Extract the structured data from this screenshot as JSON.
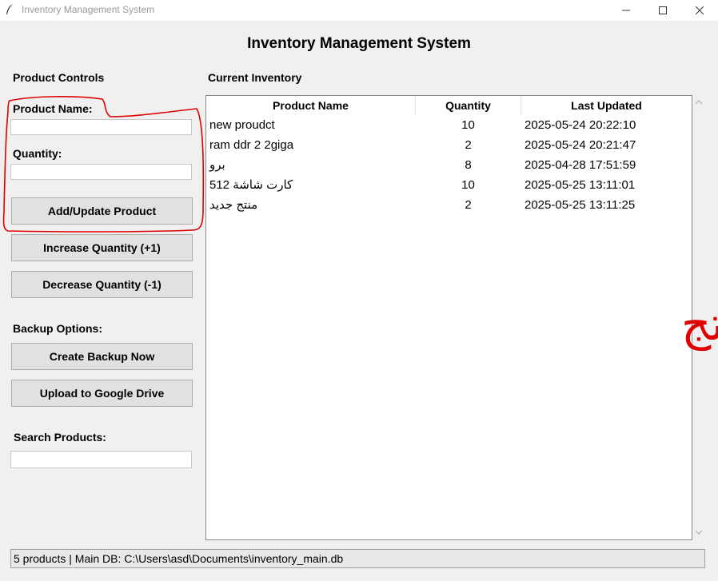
{
  "window": {
    "title": "Inventory Management System"
  },
  "app": {
    "title": "Inventory Management System"
  },
  "controls": {
    "heading": "Product Controls",
    "product_name_label": "Product Name:",
    "quantity_label": "Quantity:",
    "add_update_label": "Add/Update Product",
    "increase_label": "Increase Quantity (+1)",
    "decrease_label": "Decrease Quantity (-1)",
    "backup_heading": "Backup Options:",
    "create_backup_label": "Create Backup Now",
    "upload_drive_label": "Upload to Google Drive",
    "search_label": "Search Products:"
  },
  "inventory": {
    "heading": "Current Inventory",
    "columns": [
      "Product Name",
      "Quantity",
      "Last Updated"
    ],
    "rows": [
      {
        "name": "new proudct",
        "quantity": "10",
        "updated": "2025-05-24 20:22:10"
      },
      {
        "name": "ram ddr 2  2giga",
        "quantity": "2",
        "updated": "2025-05-24 20:21:47"
      },
      {
        "name": "برو",
        "quantity": "8",
        "updated": "2025-04-28 17:51:59"
      },
      {
        "name": "كارت شاشة 512",
        "quantity": "10",
        "updated": "2025-05-25 13:11:01"
      },
      {
        "name": "منتج جديد",
        "quantity": "2",
        "updated": "2025-05-25 13:11:25"
      }
    ]
  },
  "status": {
    "text": "5 products | Main DB: C:\\Users\\asd\\Documents\\inventory_main.db"
  },
  "annotation": {
    "text": "اضافة وتعديل منتج",
    "color": "#e00000"
  }
}
